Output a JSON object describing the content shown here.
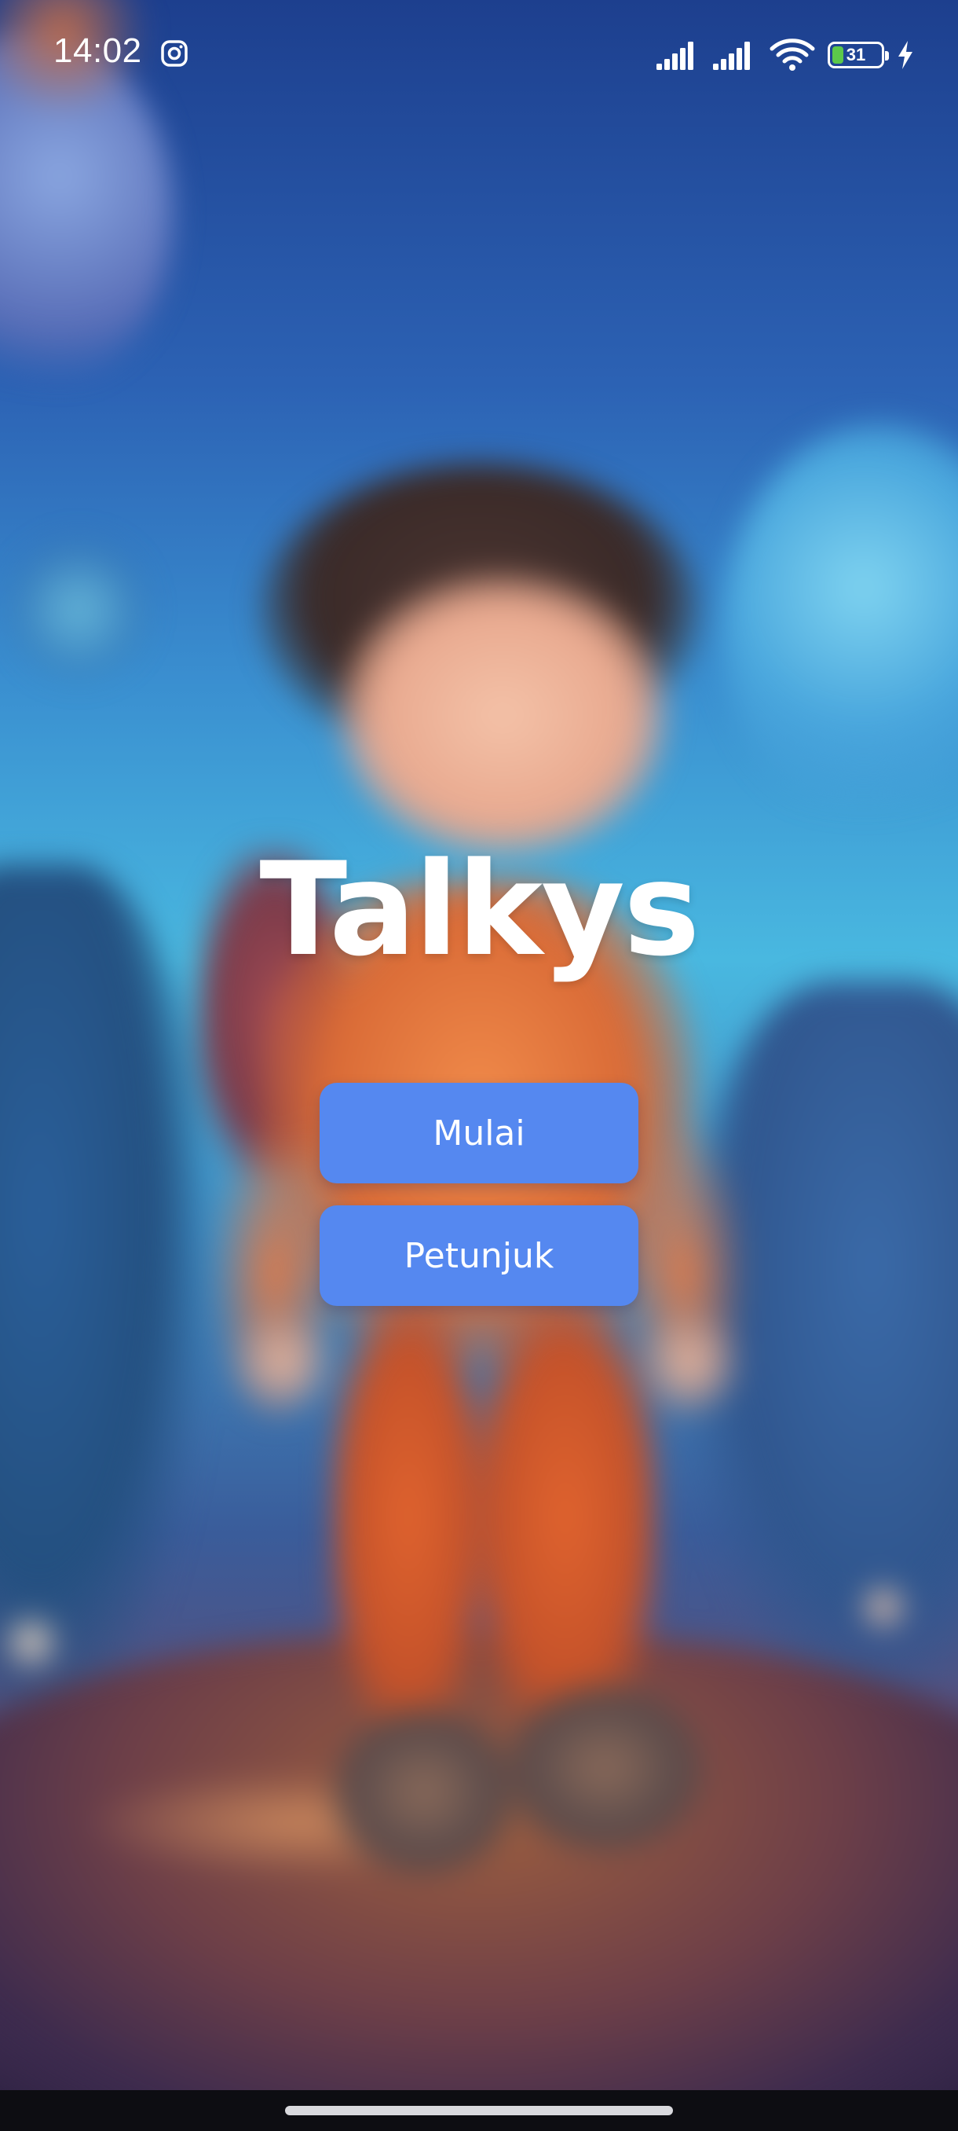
{
  "status_bar": {
    "time": "14:02",
    "battery_level": "31",
    "battery_fraction": 0.31,
    "icons": [
      "instagram-icon",
      "signal-icon",
      "signal-icon",
      "wifi-icon",
      "battery-icon",
      "charging-icon"
    ]
  },
  "app": {
    "title": "Talkys"
  },
  "buttons": {
    "start_label": "Mulai",
    "guide_label": "Petunjuk"
  },
  "colors": {
    "button": "#5588f0",
    "title": "#ffffff",
    "battery_fill": "#5cc84a"
  }
}
